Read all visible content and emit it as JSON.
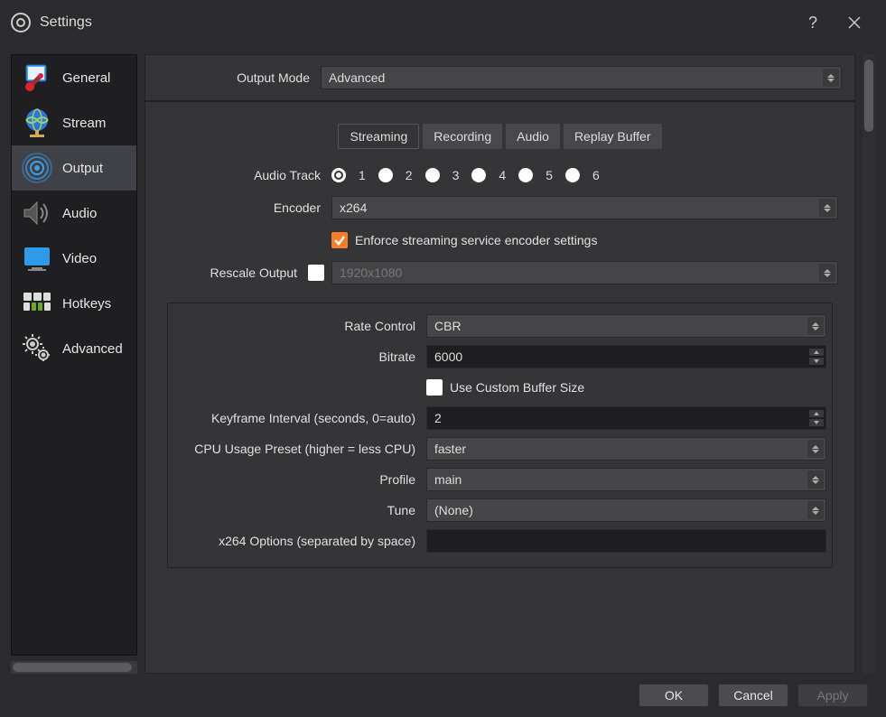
{
  "window": {
    "title": "Settings"
  },
  "sidebar": {
    "items": [
      {
        "label": "General"
      },
      {
        "label": "Stream"
      },
      {
        "label": "Output"
      },
      {
        "label": "Audio"
      },
      {
        "label": "Video"
      },
      {
        "label": "Hotkeys"
      },
      {
        "label": "Advanced"
      }
    ],
    "selected_index": 2
  },
  "output_mode": {
    "label": "Output Mode",
    "value": "Advanced"
  },
  "tabs": {
    "items": [
      {
        "label": "Streaming"
      },
      {
        "label": "Recording"
      },
      {
        "label": "Audio"
      },
      {
        "label": "Replay Buffer"
      }
    ],
    "active_index": 0
  },
  "audio_track": {
    "label": "Audio Track",
    "options": [
      "1",
      "2",
      "3",
      "4",
      "5",
      "6"
    ],
    "selected": "1"
  },
  "encoder": {
    "label": "Encoder",
    "value": "x264"
  },
  "enforce": {
    "label": "Enforce streaming service encoder settings",
    "checked": true
  },
  "rescale": {
    "label": "Rescale Output",
    "checked": false,
    "value": "1920x1080"
  },
  "rate_control": {
    "label": "Rate Control",
    "value": "CBR"
  },
  "bitrate": {
    "label": "Bitrate",
    "value": "6000"
  },
  "custom_buffer": {
    "label": "Use Custom Buffer Size",
    "checked": false
  },
  "keyframe": {
    "label": "Keyframe Interval (seconds, 0=auto)",
    "value": "2"
  },
  "cpu_preset": {
    "label": "CPU Usage Preset (higher = less CPU)",
    "value": "faster"
  },
  "profile": {
    "label": "Profile",
    "value": "main"
  },
  "tune": {
    "label": "Tune",
    "value": "(None)"
  },
  "x264_opts": {
    "label": "x264 Options (separated by space)",
    "value": ""
  },
  "buttons": {
    "ok": "OK",
    "cancel": "Cancel",
    "apply": "Apply"
  }
}
